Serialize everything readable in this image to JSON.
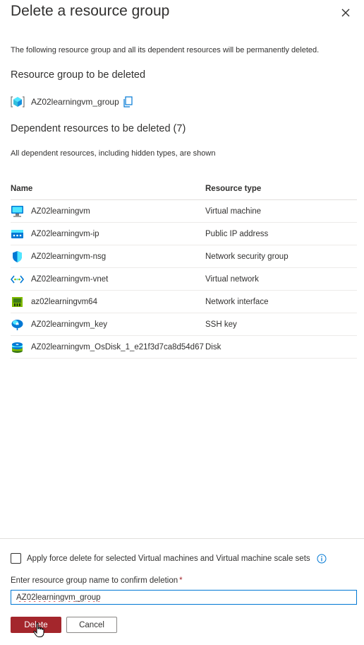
{
  "header": {
    "title": "Delete a resource group",
    "close_icon": "close-icon"
  },
  "intro_text": "The following resource group and all its dependent resources will be permanently deleted.",
  "resource_group_section": {
    "title": "Resource group to be deleted",
    "name": "AZ02learningvm_group",
    "icon": "resource-group-icon",
    "copy_icon": "copy-icon"
  },
  "dependent_section": {
    "title": "Dependent resources to be deleted (7)",
    "note": "All dependent resources, including hidden types, are shown"
  },
  "table": {
    "columns": [
      "Name",
      "Resource type"
    ],
    "rows": [
      {
        "name": "AZ02learningvm",
        "type": "Virtual machine",
        "icon": "virtual-machine-icon"
      },
      {
        "name": "AZ02learningvm-ip",
        "type": "Public IP address",
        "icon": "public-ip-icon"
      },
      {
        "name": "AZ02learningvm-nsg",
        "type": "Network security group",
        "icon": "network-security-group-icon"
      },
      {
        "name": "AZ02learningvm-vnet",
        "type": "Virtual network",
        "icon": "virtual-network-icon"
      },
      {
        "name": "az02learningvm64",
        "type": "Network interface",
        "icon": "network-interface-icon"
      },
      {
        "name": "AZ02learningvm_key",
        "type": "SSH key",
        "icon": "ssh-key-icon"
      },
      {
        "name": "AZ02learningvm_OsDisk_1_e21f3d7ca8d54d67",
        "type": "Disk",
        "icon": "disk-icon"
      }
    ]
  },
  "footer": {
    "force_delete_label": "Apply force delete for selected Virtual machines and Virtual machine scale sets",
    "force_delete_checked": false,
    "confirm_label": "Enter resource group name to confirm deletion",
    "required_mark": "*",
    "confirm_value": "AZ02learningvm_group",
    "delete_label": "Delete",
    "cancel_label": "Cancel"
  },
  "colors": {
    "delete_button": "#a4262c",
    "input_focus_border": "#0078d4",
    "link_blue": "#0078d4"
  }
}
